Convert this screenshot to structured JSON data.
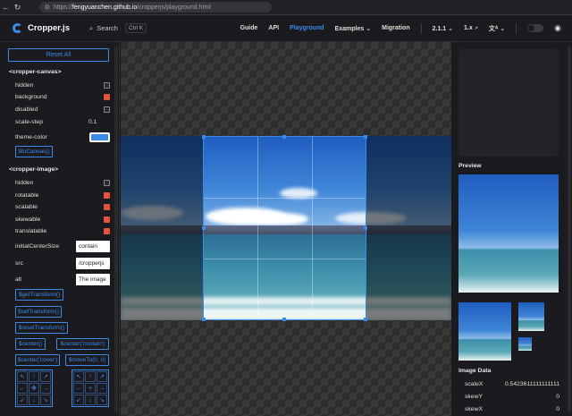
{
  "browser": {
    "back_icon": "arrow-left-icon",
    "reload_icon": "reload-icon",
    "url_prefix": "https://",
    "url_host": "fengyuanchen.github.io",
    "url_path": "/cropperjs/playground.html"
  },
  "nav": {
    "brand": "Cropper.js",
    "search_label": "Search",
    "search_shortcut": "Ctrl K",
    "links": [
      "Guide",
      "API",
      "Playground",
      "Examples",
      "Migration"
    ],
    "active": "Playground",
    "version": "2.1.1",
    "version_alt": "1.x",
    "colors": {
      "accent": "#3a8ae6",
      "background": "#1b1b1f"
    }
  },
  "sidebar": {
    "reset_label": "Reset All",
    "canvas_section": "<cropper-canvas>",
    "canvas_options": [
      {
        "label": "hidden",
        "checked": false
      },
      {
        "label": "background",
        "checked": true
      },
      {
        "label": "disabled",
        "checked": false
      }
    ],
    "scale_step_label": "scale-step",
    "scale_step_value": "0.1",
    "theme_color_label": "theme-color",
    "theme_color_value": "#3a8ae6",
    "to_canvas_button": "$toCanvas()",
    "image_section": "<cropper-image>",
    "image_options": [
      {
        "label": "hidden",
        "checked": false
      },
      {
        "label": "rotatable",
        "checked": true
      },
      {
        "label": "scalable",
        "checked": true
      },
      {
        "label": "skewable",
        "checked": true
      },
      {
        "label": "translatable",
        "checked": true
      }
    ],
    "initial_center_size_label": "initialCenterSize",
    "initial_center_size_value": "contain",
    "src_label": "src",
    "src_value": "/cropperjs",
    "alt_label": "alt",
    "alt_value": "The image",
    "buttons": {
      "get_transform": "$getTransform()",
      "set_transform": "$setTransform()",
      "reset_transform": "$resetTransform()",
      "center": "$center()",
      "center_contain": "$center('contain')",
      "center_cover": "$center('cover')",
      "move_to": "$moveTo(0, 0)"
    },
    "move_pad": [
      "↖",
      "↑",
      "↗",
      "←",
      "✥",
      "→",
      "↙",
      "↓",
      "↘"
    ],
    "rotate_pad": [
      "↖",
      "↑",
      "↗",
      "←",
      "+",
      "→",
      "↙",
      "↓",
      "↘"
    ]
  },
  "right_panel": {
    "preview_label": "Preview",
    "image_data_label": "Image Data",
    "image_data": [
      {
        "key": "scaleX",
        "value": "0.5423611111111111"
      },
      {
        "key": "skewY",
        "value": "0"
      },
      {
        "key": "skewX",
        "value": "0"
      }
    ]
  }
}
